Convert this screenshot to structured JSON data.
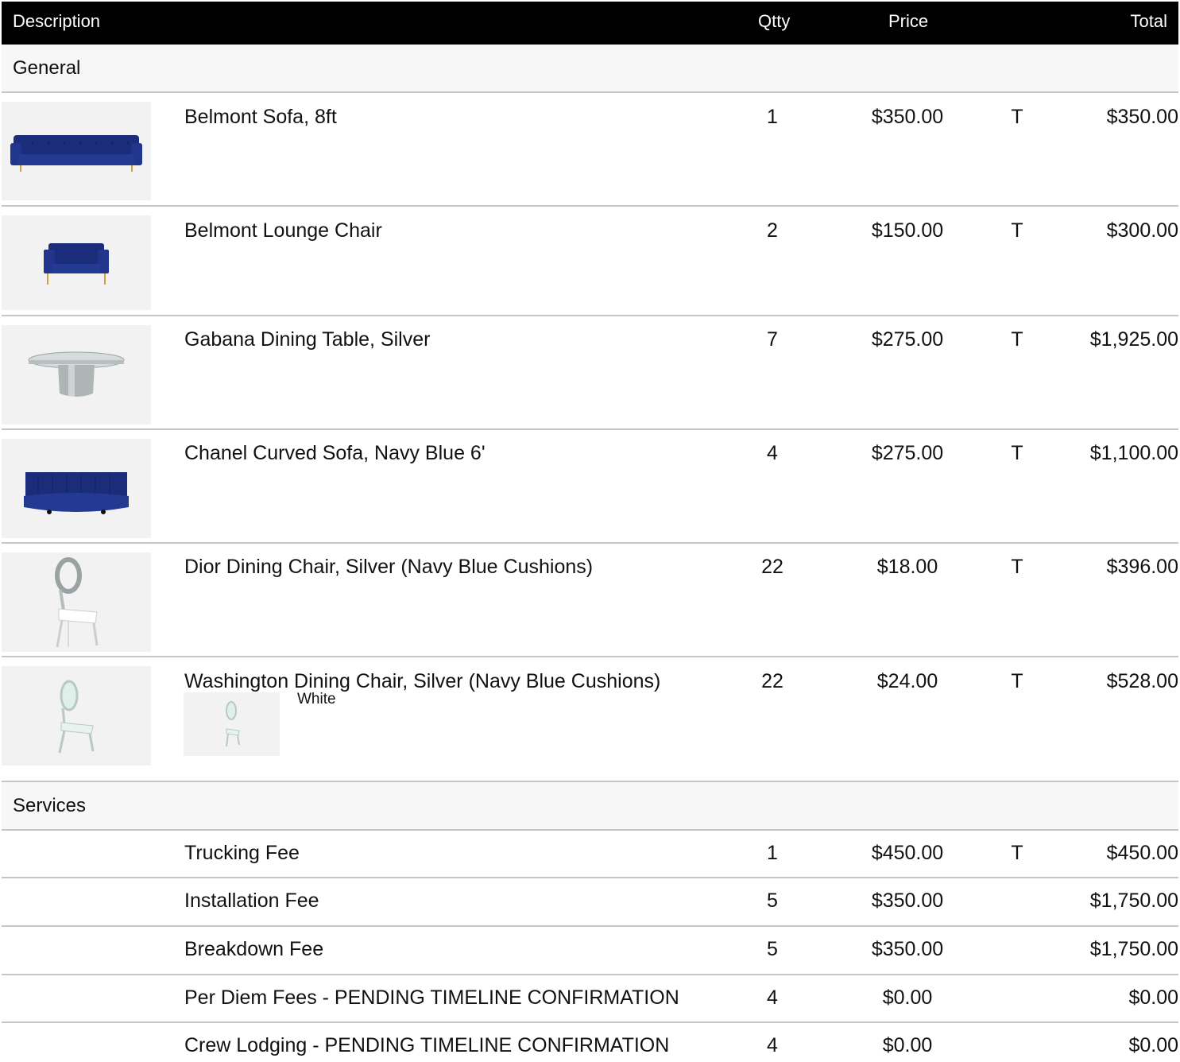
{
  "header": {
    "description": "Description",
    "qty": "Qtty",
    "price": "Price",
    "total": "Total"
  },
  "sections": {
    "general": "General",
    "services": "Services"
  },
  "general_items": [
    {
      "description": "Belmont Sofa, 8ft",
      "qty": "1",
      "price": "$350.00",
      "tax": "T",
      "total": "$350.00",
      "icon": "navy-tufted-sofa"
    },
    {
      "description": "Belmont Lounge Chair",
      "qty": "2",
      "price": "$150.00",
      "tax": "T",
      "total": "$300.00",
      "icon": "navy-lounge-chair"
    },
    {
      "description": "Gabana Dining Table, Silver",
      "qty": "7",
      "price": "$275.00",
      "tax": "T",
      "total": "$1,925.00",
      "icon": "silver-round-table"
    },
    {
      "description": "Chanel Curved Sofa, Navy Blue 6'",
      "qty": "4",
      "price": "$275.00",
      "tax": "T",
      "total": "$1,100.00",
      "icon": "navy-curved-sofa"
    },
    {
      "description": "Dior Dining Chair, Silver (Navy Blue Cushions)",
      "qty": "22",
      "price": "$18.00",
      "tax": "T",
      "total": "$396.00",
      "icon": "silver-dior-chair"
    },
    {
      "description": "Washington Dining Chair, Silver (Navy Blue Cushions)",
      "qty": "22",
      "price": "$24.00",
      "tax": "T",
      "total": "$528.00",
      "icon": "silver-washington-chair",
      "option": "White"
    }
  ],
  "service_items": [
    {
      "description": "Trucking Fee",
      "qty": "1",
      "price": "$450.00",
      "tax": "T",
      "total": "$450.00"
    },
    {
      "description": "Installation Fee",
      "qty": "5",
      "price": "$350.00",
      "tax": "",
      "total": "$1,750.00"
    },
    {
      "description": "Breakdown Fee",
      "qty": "5",
      "price": "$350.00",
      "tax": "",
      "total": "$1,750.00"
    },
    {
      "description": "Per Diem Fees - PENDING TIMELINE CONFIRMATION",
      "qty": "4",
      "price": "$0.00",
      "tax": "",
      "total": "$0.00"
    },
    {
      "description": "Crew Lodging - PENDING TIMELINE CONFIRMATION",
      "qty": "4",
      "price": "$0.00",
      "tax": "",
      "total": "$0.00"
    }
  ],
  "colors": {
    "header_bg": "#000000",
    "section_bg": "#f7f7f7",
    "divider": "#c6c6c6",
    "navy": "#1b2d7a",
    "silver": "#c9cfcf"
  }
}
